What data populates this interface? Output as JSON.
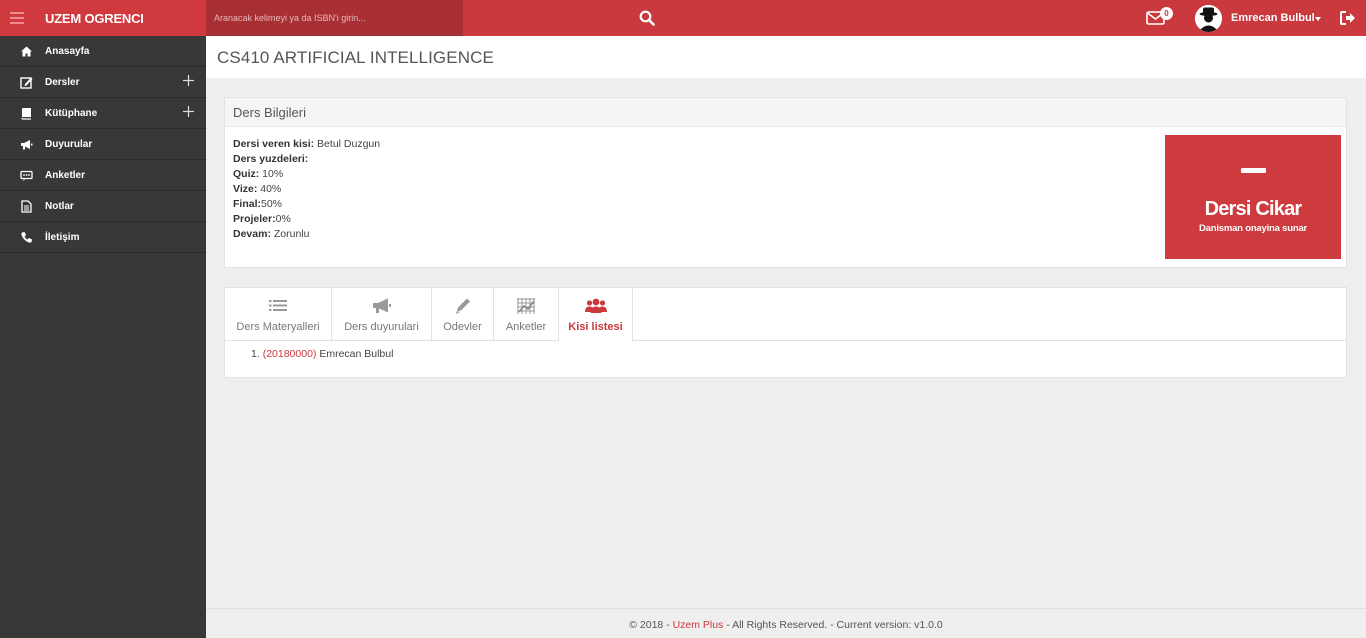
{
  "app": {
    "title": "UZEM OGRENCI",
    "search_placeholder": "Aranacak kelimeyi ya da ISBN'i girin...",
    "mail_count": "0",
    "user_name": "Emrecan Bulbul"
  },
  "sidebar": {
    "items": [
      {
        "label": "Anasayfa",
        "icon": "home-icon"
      },
      {
        "label": "Dersler",
        "icon": "edit-icon"
      },
      {
        "label": "Kütüphane",
        "icon": "book-icon"
      },
      {
        "label": "Duyurular",
        "icon": "megaphone-icon"
      },
      {
        "label": "Anketler",
        "icon": "survey-icon"
      },
      {
        "label": "Notlar",
        "icon": "notes-icon"
      },
      {
        "label": "İletişim",
        "icon": "phone-icon"
      }
    ]
  },
  "page": {
    "title": "CS410 ARTIFICIAL INTELLIGENCE"
  },
  "course_info": {
    "heading": "Ders Bilgileri",
    "instructor_label": "Dersi veren kisi:",
    "instructor_value": " Betul Duzgun",
    "percentages_label": "Ders yuzdeleri:",
    "quiz_label": "Quiz:",
    "quiz_value": " 10%",
    "midterm_label": "Vize:",
    "midterm_value": " 40%",
    "final_label": "Final:",
    "final_value": "50%",
    "projects_label": "Projeler:",
    "projects_value": "0%",
    "attendance_label": "Devam:",
    "attendance_value": " Zorunlu"
  },
  "drop_button": {
    "title": "Dersi Cikar",
    "subtitle": "Danisman onayina sunar"
  },
  "tabs": [
    {
      "label": "Ders Materyalleri",
      "icon": "list-icon",
      "active": false
    },
    {
      "label": "Ders duyurulari",
      "icon": "megaphone-icon",
      "active": false
    },
    {
      "label": "Odevler",
      "icon": "pencil-icon",
      "active": false
    },
    {
      "label": "Anketler",
      "icon": "grid-icon",
      "active": false
    },
    {
      "label": "Kisi listesi",
      "icon": "users-icon",
      "active": true
    }
  ],
  "person_list": [
    {
      "number": "1.",
      "open": "(",
      "id": "20180000",
      "close": ")",
      "name": " Emrecan Bulbul"
    }
  ],
  "footer": {
    "prefix": "© 2018 - ",
    "brand": "Uzem Plus",
    "suffix": " - All Rights Reserved. - Current version: v1.0.0"
  },
  "colors": {
    "accent": "#c9393d",
    "sidebar": "#383838",
    "search_bg": "#a82f33"
  }
}
